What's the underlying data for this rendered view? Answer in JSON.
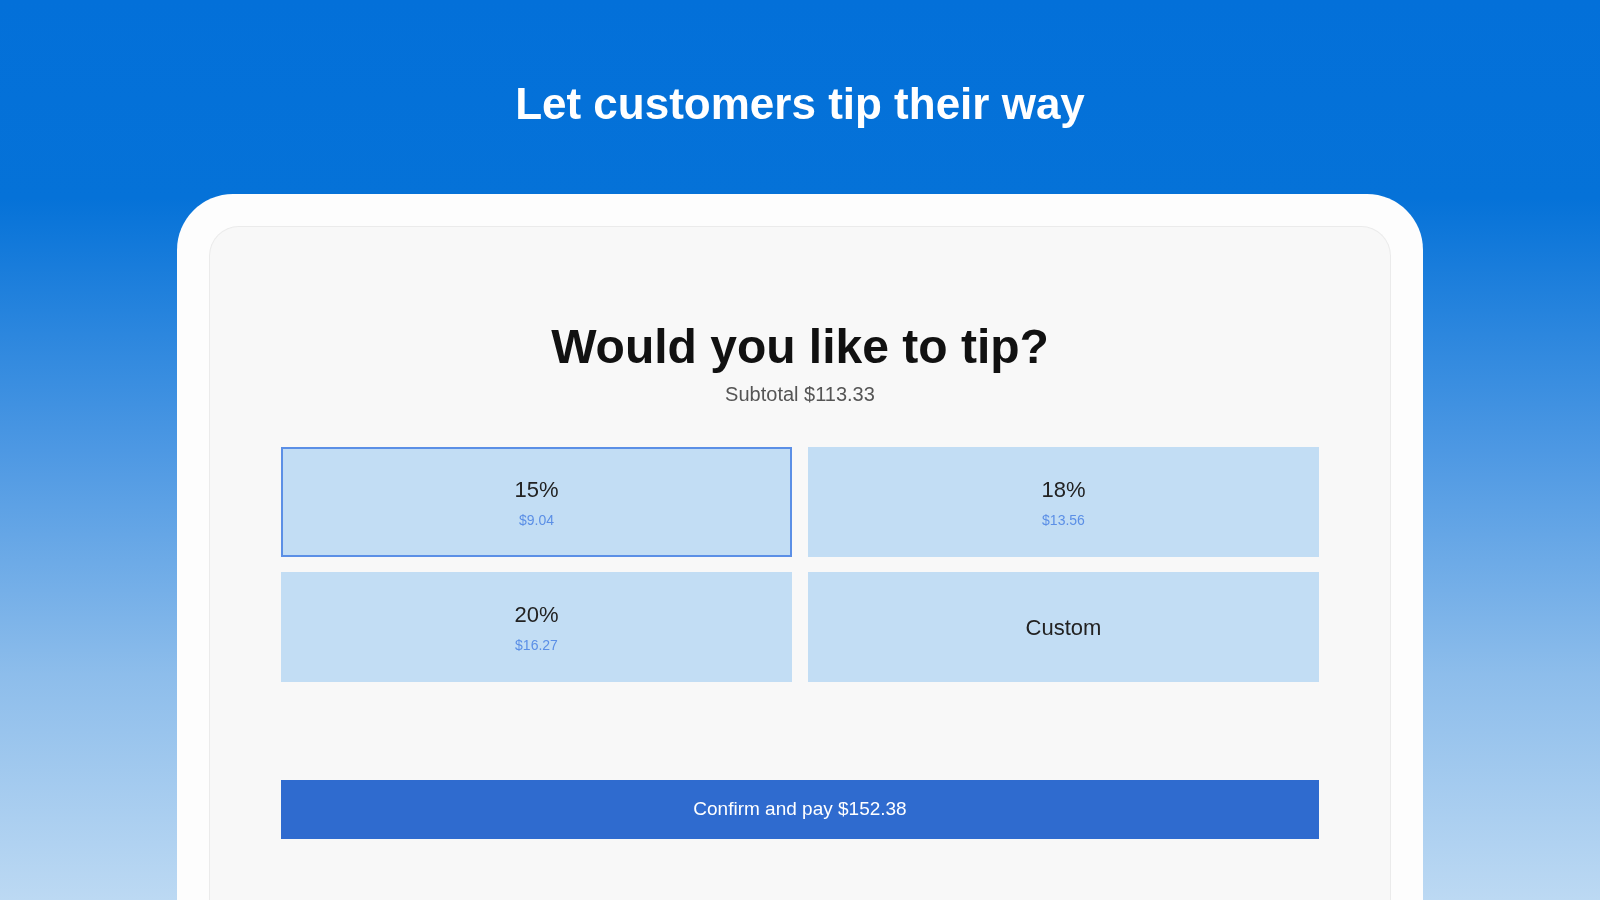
{
  "headline": "Let customers tip their way",
  "screen": {
    "title": "Would you like to tip?",
    "subtotal": "Subtotal $113.33",
    "options": [
      {
        "label": "15%",
        "amount": "$9.04",
        "selected": true
      },
      {
        "label": "18%",
        "amount": "$13.56",
        "selected": false
      },
      {
        "label": "20%",
        "amount": "$16.27",
        "selected": false
      },
      {
        "label": "Custom",
        "selected": false
      }
    ],
    "confirm_button": "Confirm and pay $152.38"
  }
}
